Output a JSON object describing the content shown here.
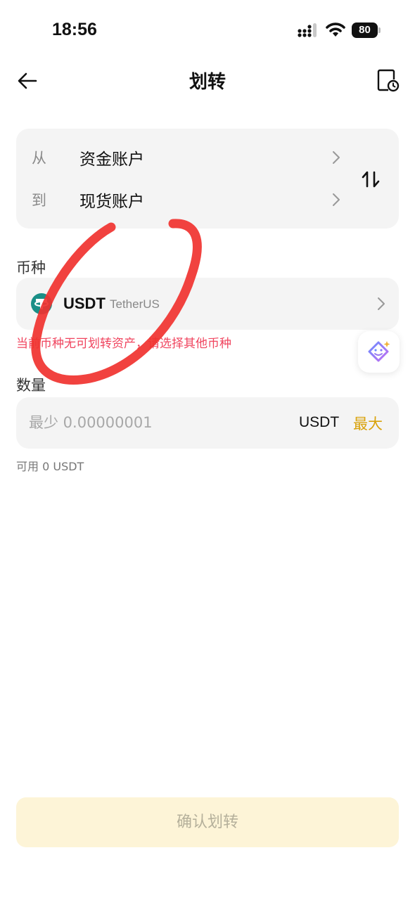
{
  "status_bar": {
    "time": "18:56",
    "battery": "80"
  },
  "nav": {
    "title": "划转"
  },
  "accounts": {
    "from_prefix": "从",
    "from_account": "资金账户",
    "to_prefix": "到",
    "to_account": "现货账户"
  },
  "coin": {
    "label": "币种",
    "symbol": "USDT",
    "name": "TetherUS",
    "error": "当前币种无可划转资产，请选择其他币种"
  },
  "quantity": {
    "label": "数量",
    "placeholder": "最少 0.00000001",
    "unit": "USDT",
    "max_label": "最大",
    "available": "可用 0 USDT"
  },
  "confirm_label": "确认划转",
  "colors": {
    "error": "#f0455f",
    "accent": "#d9a20b",
    "confirm_bg": "#fdf4d7",
    "card_bg": "#f4f4f4",
    "coin_logo": "#1a8f87",
    "annotation": "#f0322f"
  }
}
